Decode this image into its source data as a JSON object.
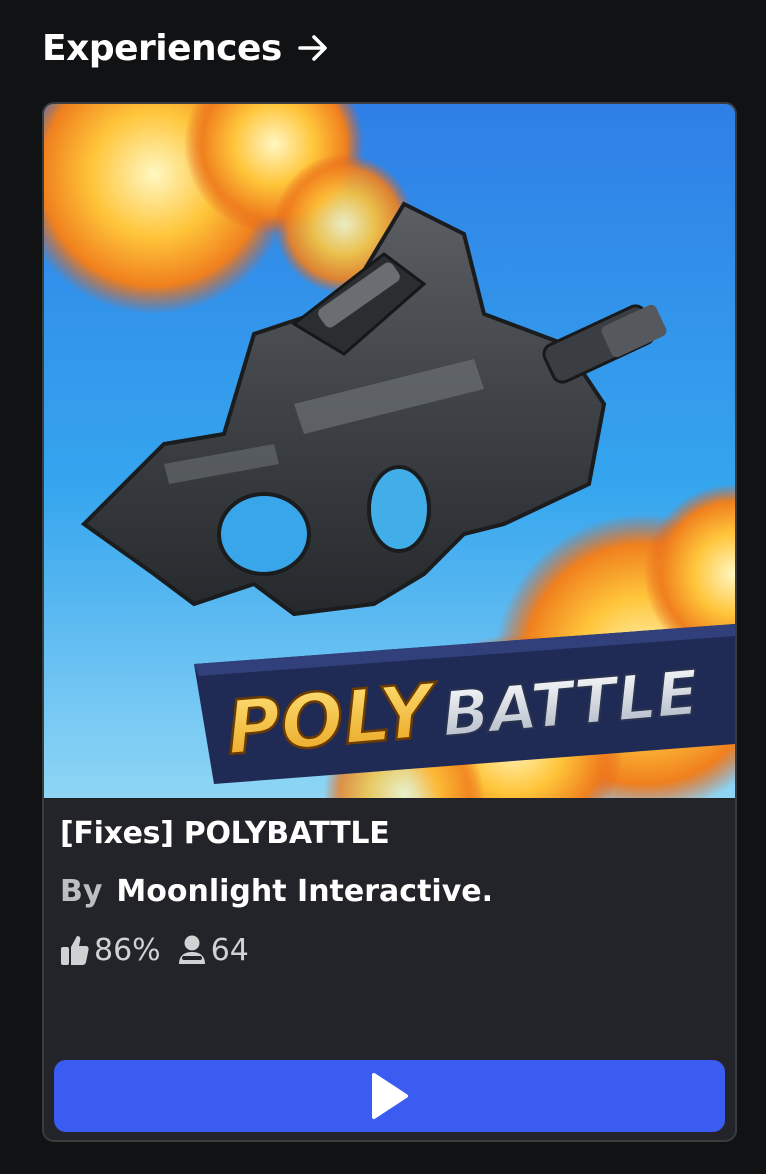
{
  "section": {
    "title": "Experiences",
    "arrow_icon": "arrow-right-icon"
  },
  "game": {
    "thumbnail_text_left": "POLY",
    "thumbnail_text_right": "BATTLE",
    "title": "[Fixes] POLYBATTLE",
    "by_label": "By",
    "creator": "Moonlight Interactive.",
    "rating": "86%",
    "rating_icon": "thumbs-up-icon",
    "players": "64",
    "players_icon": "player-count-icon"
  },
  "play_button": {
    "icon": "play-icon"
  },
  "colors": {
    "background": "#111214",
    "card": "#232429",
    "play_button": "#3b5cf1"
  }
}
